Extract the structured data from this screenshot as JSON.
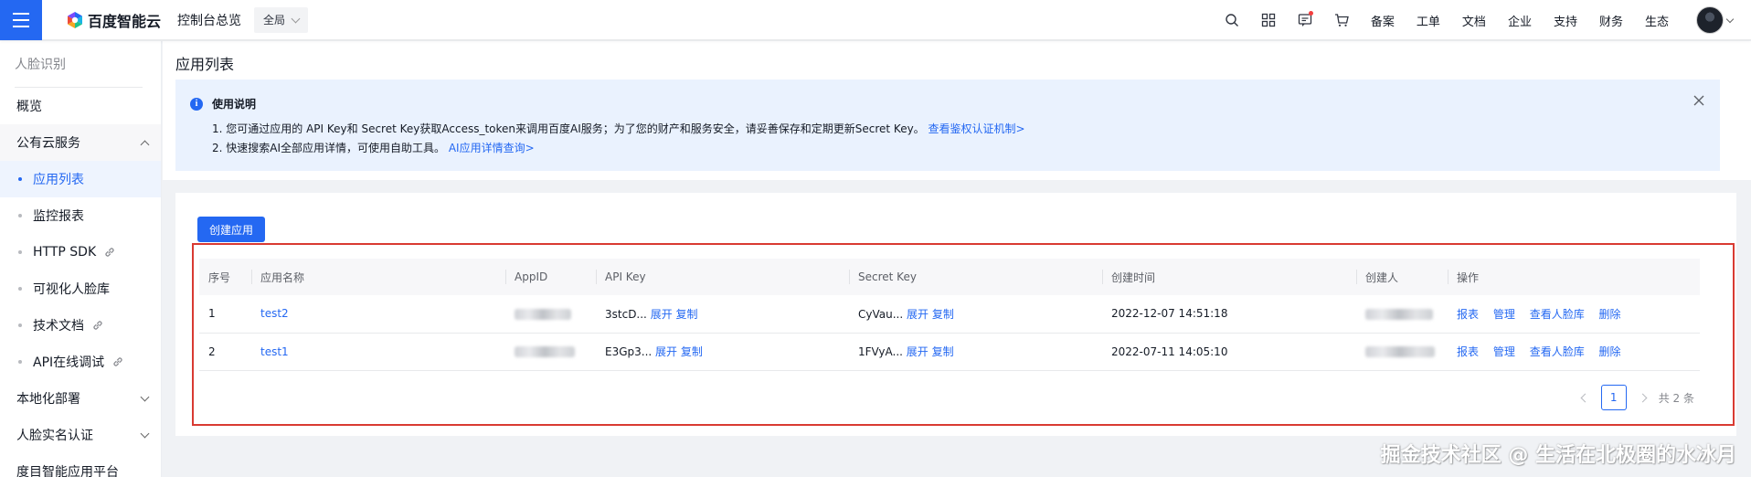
{
  "header": {
    "logo_text": "百度智能云",
    "console_label": "控制台总览",
    "region": "全局",
    "links": [
      "备案",
      "工单",
      "文档",
      "企业",
      "支持",
      "财务",
      "生态"
    ]
  },
  "sidebar": {
    "title": "人脸识别",
    "items": [
      {
        "label": "概览"
      },
      {
        "label": "公有云服务"
      },
      {
        "label": "应用列表"
      },
      {
        "label": "监控报表"
      },
      {
        "label": "HTTP SDK"
      },
      {
        "label": "可视化人脸库"
      },
      {
        "label": "技术文档"
      },
      {
        "label": "API在线调试"
      },
      {
        "label": "本地化部署"
      },
      {
        "label": "人脸实名认证"
      },
      {
        "label": "度目智能应用平台"
      }
    ]
  },
  "main": {
    "page_title": "应用列表",
    "notice": {
      "title": "使用说明",
      "line1": "1. 您可通过应用的 API Key和 Secret Key获取Access_token来调用百度AI服务；为了您的财产和服务安全，请妥善保存和定期更新Secret Key。",
      "line1_link": "查看鉴权认证机制>",
      "line2": "2. 快速搜索AI全部应用详情，可使用自助工具。",
      "line2_link": "AI应用详情查询>"
    },
    "create_button": "创建应用",
    "table": {
      "headers": [
        "序号",
        "应用名称",
        "AppID",
        "API Key",
        "Secret Key",
        "创建时间",
        "创建人",
        "操作"
      ],
      "rows": [
        {
          "no": "1",
          "name": "test2",
          "api_key": "3stcD...",
          "secret_key": "CyVau...",
          "created": "2022-12-07 14:51:18"
        },
        {
          "no": "2",
          "name": "test1",
          "api_key": "E3Gp3...",
          "secret_key": "1FVyA...",
          "created": "2022-07-11 14:05:10"
        }
      ],
      "expand_label": "展开",
      "copy_label": "复制",
      "actions": [
        "报表",
        "管理",
        "查看人脸库",
        "删除"
      ]
    },
    "pagination": {
      "page": "1",
      "total": "共 2 条"
    }
  },
  "watermark": "掘金技术社区 @ 生活在北极圈的水冰月",
  "colors": {
    "accent": "#2468f2",
    "highlight_border": "#d93a32",
    "notice_bg": "#eaf2fe"
  }
}
